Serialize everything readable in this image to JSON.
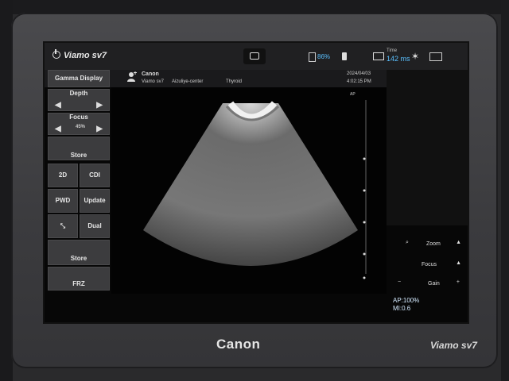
{
  "topbar": {
    "app_name": "Viamo sv7",
    "battery": "86%",
    "time_label": "Time",
    "time_value": "142 ms"
  },
  "info": {
    "logo": "Canon",
    "system": "Viamo sv7",
    "center": "Aizuliye-center",
    "exam": "Thyroid",
    "date": "2024/04/03",
    "time": "4:02:15 PM"
  },
  "left": {
    "gamma_display": "Gamma Display",
    "depth": "Depth",
    "focus": "Focus",
    "focus_value": "45%",
    "store_top": "Store",
    "b2d": "2D",
    "cdi": "CDI",
    "pwd": "PWD",
    "update": "Update",
    "dual": "Dual",
    "store": "Store",
    "frz": "FRZ"
  },
  "right": {
    "zoom": "Zoom",
    "focus": "Focus",
    "gain": "Gain",
    "plus": "+",
    "minus": "−"
  },
  "status": {
    "ap": "AP:100%",
    "mi": "MI:0.6"
  },
  "device": {
    "brand": "Canon",
    "model": "Viamo sv7"
  }
}
